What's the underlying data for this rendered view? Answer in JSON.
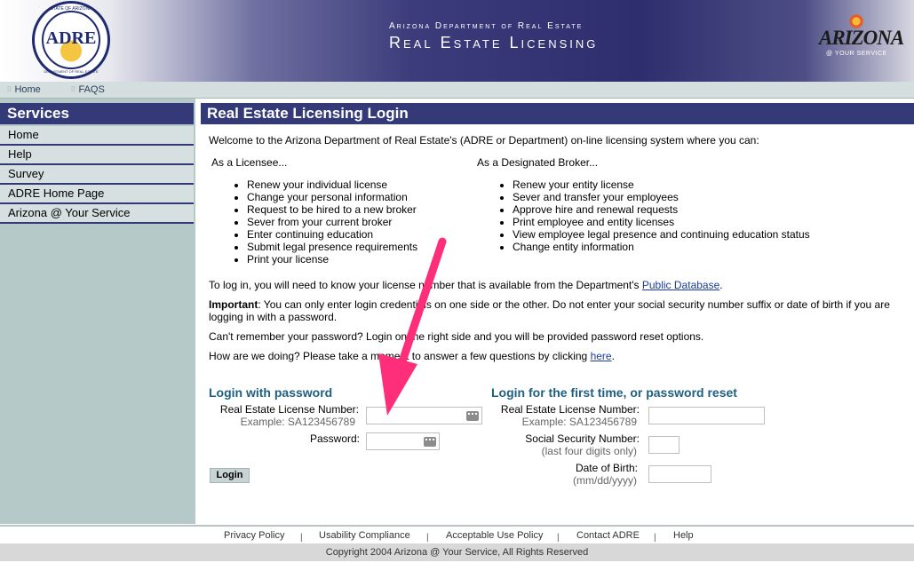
{
  "header": {
    "seal_text": "ADRE",
    "seal_ring_top": "STATE OF ARIZONA",
    "seal_ring_bottom": "DEPARTMENT OF REAL ESTATE",
    "agency": "Arizona Department of Real Estate",
    "site_title": "Real Estate Licensing",
    "az_logo_word": "ARIZONA",
    "az_logo_tag": "@ YOUR SERVICE"
  },
  "topnav": {
    "items": [
      "Home",
      "FAQS"
    ]
  },
  "sidebar": {
    "title": "Services",
    "items": [
      "Home",
      "Help",
      "Survey",
      "ADRE Home Page",
      "Arizona @ Your Service"
    ]
  },
  "main": {
    "title": "Real Estate Licensing Login",
    "welcome": "Welcome to the Arizona Department of Real Estate's (ADRE or Department) on-line licensing system where you can:",
    "licensee_head": "As a Licensee...",
    "licensee_items": [
      "Renew your individual license",
      "Change your personal information",
      "Request to be hired to a new broker",
      "Sever from your current broker",
      "Enter continuing education",
      "Submit legal presence requirements",
      "Print your license"
    ],
    "broker_head": "As a Designated Broker...",
    "broker_items": [
      "Renew your entity license",
      "Sever and transfer your employees",
      "Approve hire and renewal requests",
      "Print employee and entity licenses",
      "View employee legal presence and continuing education status",
      "Change entity information"
    ],
    "login_info": "To log in, you will need to know your license number that is available from the Department's ",
    "public_db_link": "Public Database",
    "login_info_end": ".",
    "important_label": "Important",
    "important_text": ": You can only enter login credentials on one side or the other. Do not enter your social security number suffix or date of birth if you are logging in with a password.",
    "forgot_text": "Can't remember your password? Login on the right side and you will be provided password reset options.",
    "survey_text": "How are we doing? Please take a moment to answer a few questions by clicking ",
    "survey_link": "here",
    "survey_end": "."
  },
  "login_password": {
    "title": "Login with password",
    "license_label": "Real Estate License Number:",
    "license_example": "Example: SA123456789",
    "password_label": "Password:",
    "login_button": "Login"
  },
  "login_first": {
    "title": "Login for the first time, or password reset",
    "license_label": "Real Estate License Number:",
    "license_example": "Example: SA123456789",
    "ssn_label": "Social Security Number:",
    "ssn_hint": "(last four digits only)",
    "dob_label": "Date of Birth:",
    "dob_hint": "(mm/dd/yyyy)"
  },
  "footer": {
    "links": [
      "Privacy Policy",
      "Usability Compliance",
      "Acceptable Use Policy",
      "Contact ADRE",
      "Help"
    ],
    "separator": "|",
    "copyright": "Copyright 2004 Arizona @ Your Service, All Rights Reserved"
  },
  "colors": {
    "banner_navy": "#343a78",
    "sidebar_bg": "#b6c9c9",
    "login_heading": "#1f5f80",
    "annotation_arrow": "#ff2e7a"
  }
}
